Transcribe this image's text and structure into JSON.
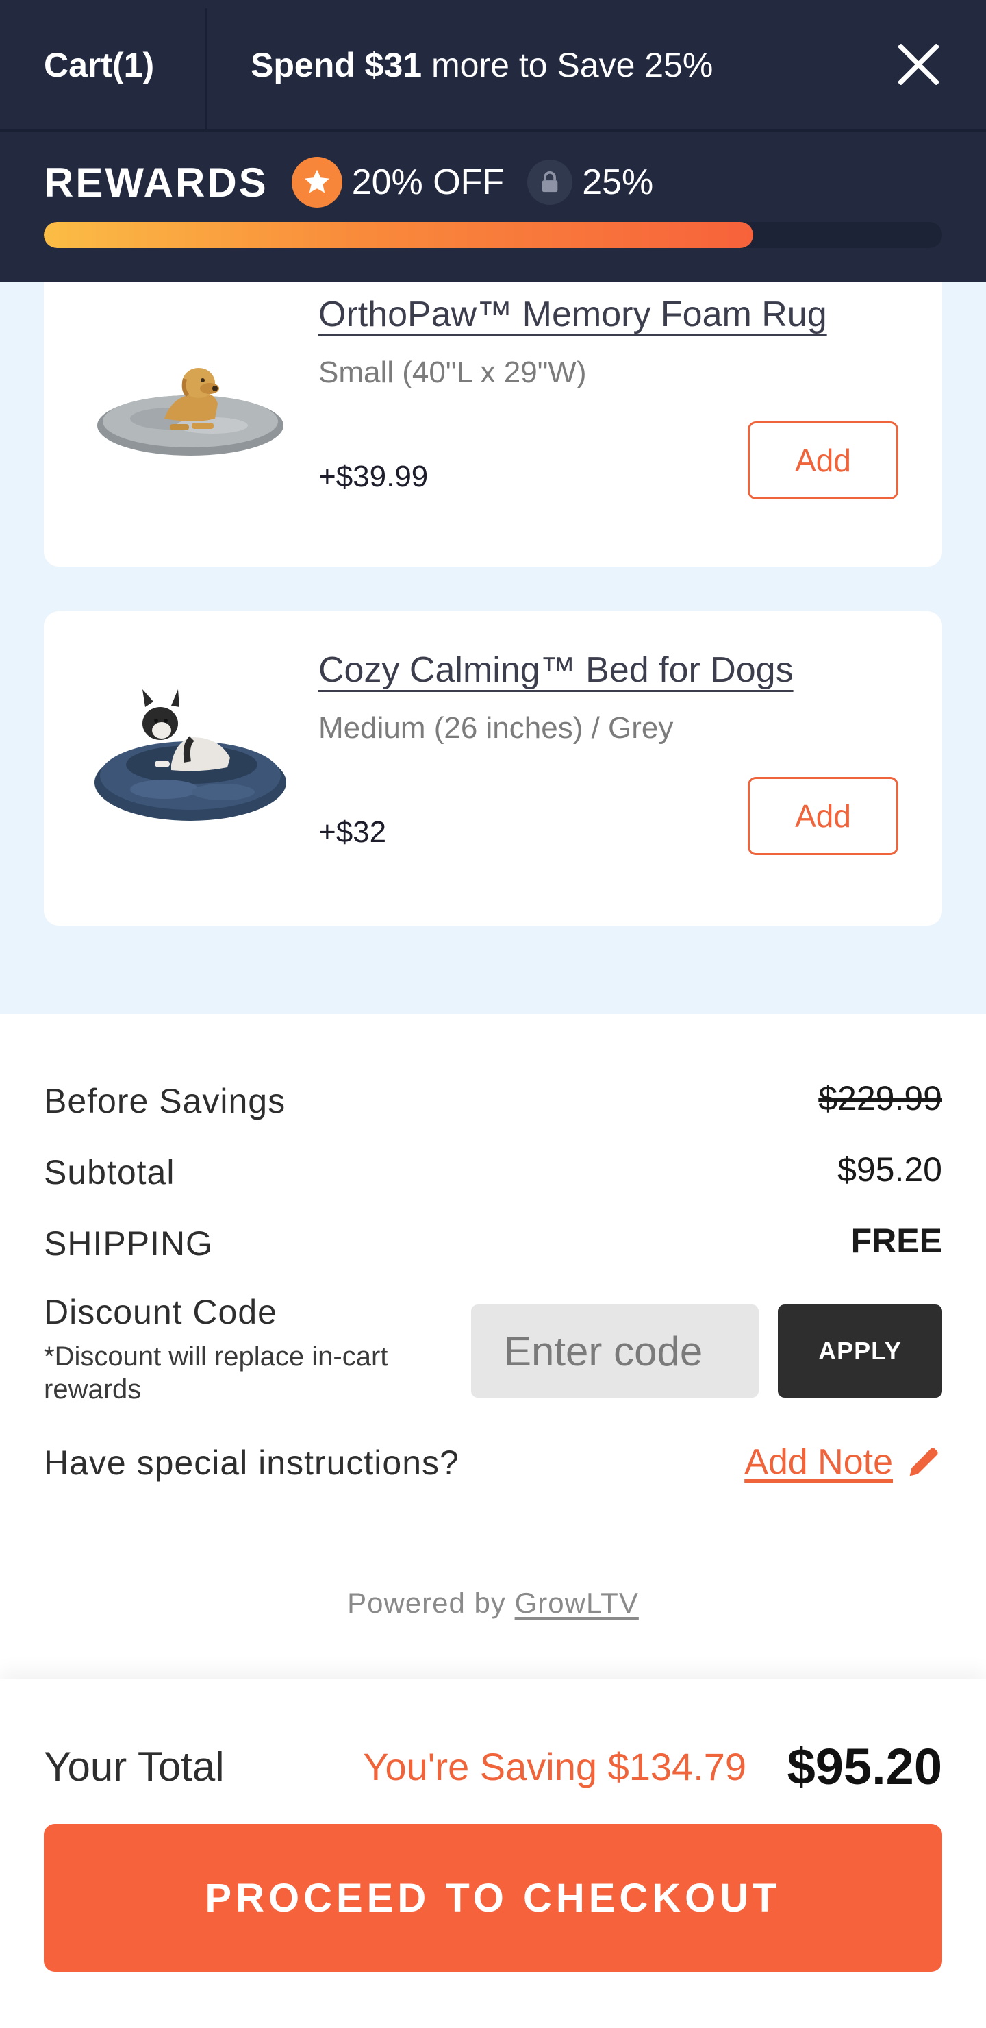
{
  "header": {
    "cart_title": "Cart(1)",
    "spend_bold": "Spend $31",
    "spend_rest": "more to Save 25%",
    "rewards_title": "REWARDS",
    "tiers": [
      {
        "label": "20% OFF",
        "icon": "star-icon",
        "unlocked": true
      },
      {
        "label": "25%",
        "icon": "lock-icon",
        "unlocked": false
      }
    ],
    "progress_percent": 79
  },
  "upsells": [
    {
      "name": "OrthoPaw™ Memory Foam Rug",
      "variant": "Small (40\"L x 29\"W)",
      "price": "+$39.99",
      "button": "Add"
    },
    {
      "name": "Cozy Calming™ Bed for Dogs",
      "variant": "Medium (26 inches) / Grey",
      "price": "+$32",
      "button": "Add"
    }
  ],
  "summary": {
    "before_label": "Before Savings",
    "before_value": "$229.99",
    "subtotal_label": "Subtotal",
    "subtotal_value": "$95.20",
    "shipping_label": "SHIPPING",
    "shipping_value": "FREE",
    "discount_label": "Discount Code",
    "discount_note": "*Discount will replace in-cart rewards",
    "discount_placeholder": "Enter code",
    "apply_label": "APPLY",
    "instructions_label": "Have special instructions?",
    "add_note_label": "Add Note",
    "powered_prefix": "Powered by",
    "powered_link": "GrowLTV"
  },
  "footer": {
    "total_label": "Your Total",
    "saving_text": "You're Saving $134.79",
    "total_value": "$95.20",
    "checkout_label": "PROCEED TO CHECKOUT"
  },
  "colors": {
    "header_bg": "#232a40",
    "accent": "#f0643b",
    "upsell_bg": "#e9f4fc"
  }
}
